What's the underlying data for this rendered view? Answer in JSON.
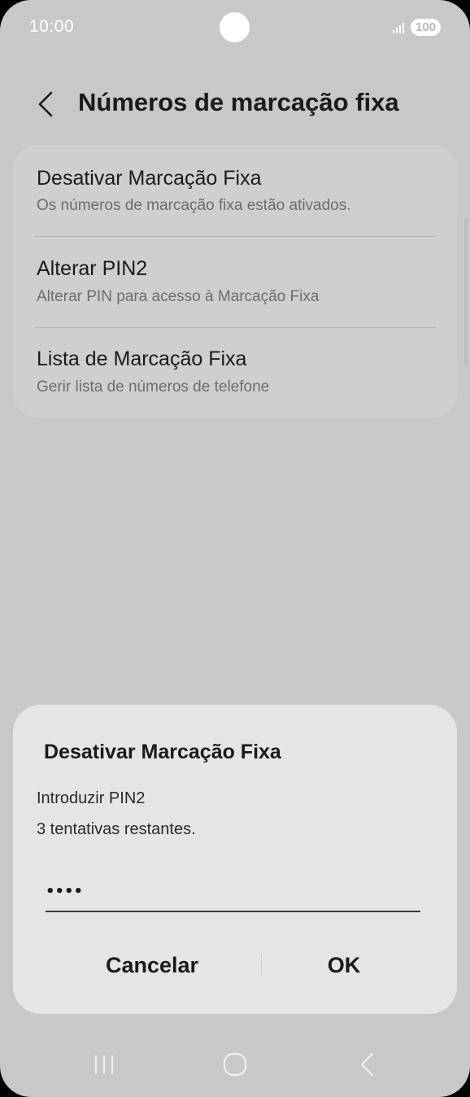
{
  "status_bar": {
    "time": "10:00",
    "battery": "100"
  },
  "header": {
    "title": "Números de marcação fixa",
    "back_icon": "chevron-left-icon"
  },
  "settings": {
    "items": [
      {
        "title": "Desativar Marcação Fixa",
        "subtitle": "Os números de marcação fixa estão ativados."
      },
      {
        "title": "Alterar PIN2",
        "subtitle": "Alterar PIN para acesso à Marcação Fixa"
      },
      {
        "title": "Lista de Marcação Fixa",
        "subtitle": "Gerir lista de números de telefone"
      }
    ]
  },
  "dialog": {
    "title": "Desativar Marcação Fixa",
    "prompt": "Introduzir PIN2",
    "attempts": "3 tentativas restantes.",
    "pin_value": "••••",
    "cancel_label": "Cancelar",
    "ok_label": "OK"
  },
  "nav_bar": {
    "icons": [
      "recent-apps-icon",
      "home-icon",
      "back-icon"
    ]
  },
  "colors": {
    "background": "#c8c8c8",
    "card": "#cfcfcf",
    "dialog": "#e5e5e5",
    "text": "#1a1a1a",
    "subtext": "#6c6c6c"
  }
}
